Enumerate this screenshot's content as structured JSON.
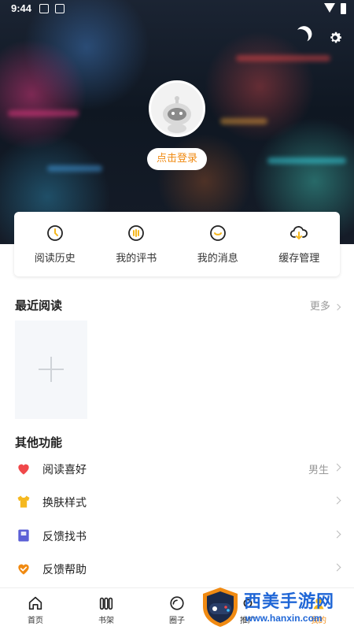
{
  "status_bar": {
    "time": "9:44"
  },
  "profile": {
    "login_label": "点击登录"
  },
  "quick_actions": [
    {
      "label": "阅读历史",
      "icon": "history-icon"
    },
    {
      "label": "我的评书",
      "icon": "comment-icon"
    },
    {
      "label": "我的消息",
      "icon": "message-icon"
    },
    {
      "label": "缓存管理",
      "icon": "cloud-download-icon"
    }
  ],
  "recent": {
    "title": "最近阅读",
    "more_label": "更多"
  },
  "other": {
    "title": "其他功能",
    "items": [
      {
        "label": "阅读喜好",
        "value": "男生",
        "icon": "heart-icon",
        "color": "#f0484a"
      },
      {
        "label": "换肤样式",
        "value": "",
        "icon": "shirt-icon",
        "color": "#f5b81f"
      },
      {
        "label": "反馈找书",
        "value": "",
        "icon": "book-icon",
        "color": "#5b5fd6"
      },
      {
        "label": "反馈帮助",
        "value": "",
        "icon": "help-heart-icon",
        "color": "#f08a12"
      }
    ]
  },
  "bottom_nav": [
    {
      "label": "首页",
      "icon": "home-icon"
    },
    {
      "label": "书架",
      "icon": "bookshelf-icon"
    },
    {
      "label": "圈子",
      "icon": "circle-icon"
    },
    {
      "label": "推广",
      "icon": "promote-icon"
    },
    {
      "label": "我的",
      "icon": "profile-icon"
    }
  ],
  "watermark": {
    "title": "西美手游网",
    "url": "www.hanxin.com"
  },
  "colors": {
    "accent": "#f08a12",
    "link_blue": "#1f66d6"
  }
}
